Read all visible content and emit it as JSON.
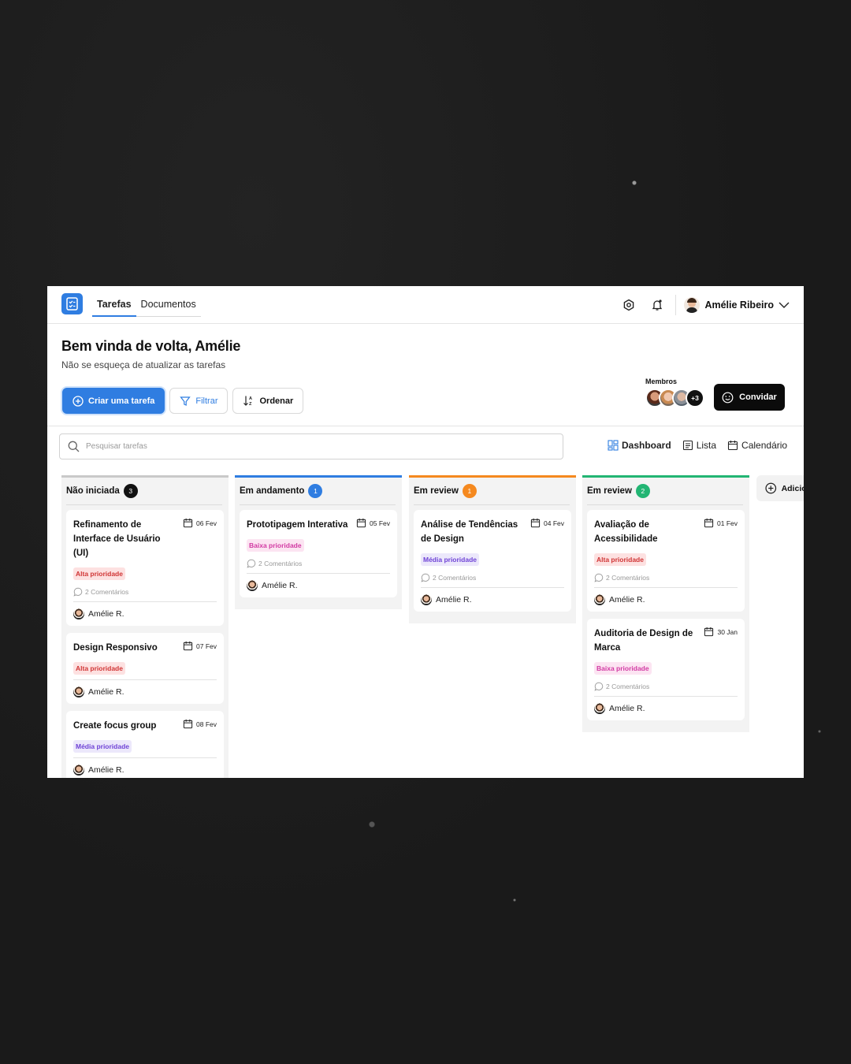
{
  "header": {
    "tabs": [
      "Tarefas",
      "Documentos"
    ],
    "active_tab": "Tarefas",
    "user_name": "Amélie Ribeiro"
  },
  "welcome": {
    "title": "Bem vinda de volta, Amélie",
    "subtitle": "Não se esqueça de atualizar as tarefas"
  },
  "actions": {
    "create": "Criar uma tarefa",
    "filter": "Filtrar",
    "sort": "Ordenar"
  },
  "members": {
    "label": "Membros",
    "more": "+3",
    "invite": "Convidar"
  },
  "search": {
    "placeholder": "Pesquisar tarefas"
  },
  "views": [
    "Dashboard",
    "Lista",
    "Calendário"
  ],
  "colors": {
    "accent": "#2f7de1",
    "col_not_started": "#c9c9c9",
    "col_in_progress": "#2f7de1",
    "col_review_orange": "#f5891f",
    "col_review_green": "#22b573"
  },
  "columns": [
    {
      "title": "Não iniciada",
      "count": "3",
      "cards": [
        {
          "title": "Refinamento de Interface de Usuário (UI)",
          "date": "06 Fev",
          "priority": "Alta prioridade",
          "comments": "2 Comentários",
          "assignee": "Amélie R."
        },
        {
          "title": "Design Responsivo",
          "date": "07 Fev",
          "priority": "Alta prioridade",
          "assignee": "Amélie R."
        },
        {
          "title": "Create focus group",
          "date": "08 Fev",
          "priority": "Média prioridade",
          "assignee": "Amélie R."
        }
      ]
    },
    {
      "title": "Em andamento",
      "count": "1",
      "cards": [
        {
          "title": "Prototipagem Interativa",
          "date": "05 Fev",
          "priority": "Baixa prioridade",
          "comments": "2 Comentários",
          "assignee": "Amélie R."
        }
      ]
    },
    {
      "title": "Em review",
      "count": "1",
      "cards": [
        {
          "title": "Análise de Tendências de Design",
          "date": "04 Fev",
          "priority": "Média prioridade",
          "comments": "2 Comentários",
          "assignee": "Amélie R."
        }
      ]
    },
    {
      "title": "Em review",
      "count": "2",
      "cards": [
        {
          "title": "Avaliação de Acessibilidade",
          "date": "01 Fev",
          "priority": "Alta prioridade",
          "comments": "2 Comentários",
          "assignee": "Amélie R."
        },
        {
          "title": "Auditoria de Design de Marca",
          "date": "30 Jan",
          "priority": "Baixa prioridade",
          "comments": "2 Comentários",
          "assignee": "Amélie R."
        }
      ]
    }
  ],
  "add_column": "Adicionar"
}
